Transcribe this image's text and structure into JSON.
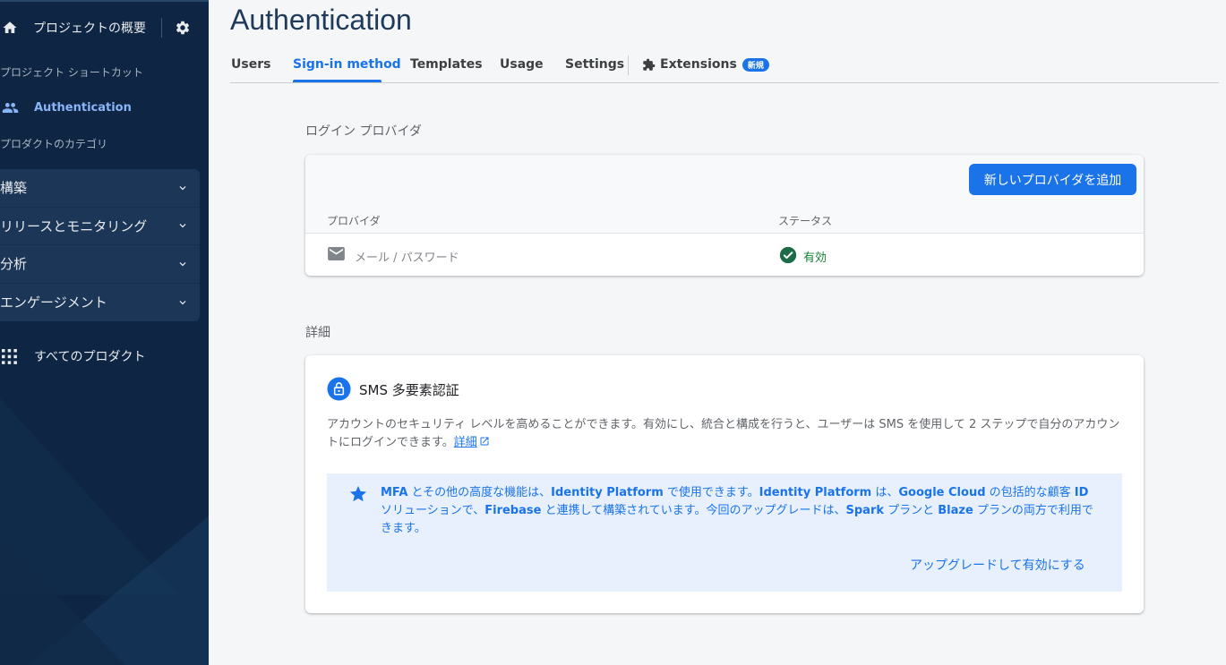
{
  "sidebar": {
    "overview_label": "プロジェクトの概要",
    "shortcuts_header": "プロジェクト ショートカット",
    "auth_label": "Authentication",
    "categories_header": "プロダクトのカテゴリ",
    "categories": [
      {
        "label": "構築"
      },
      {
        "label": "リリースとモニタリング"
      },
      {
        "label": "分析"
      },
      {
        "label": "エンゲージメント"
      }
    ],
    "all_products_label": "すべてのプロダクト"
  },
  "main": {
    "title": "Authentication",
    "tabs": [
      {
        "label": "Users"
      },
      {
        "label": "Sign-in method"
      },
      {
        "label": "Templates"
      },
      {
        "label": "Usage"
      },
      {
        "label": "Settings"
      }
    ],
    "extensions_label": "Extensions",
    "new_badge": "新規"
  },
  "providers": {
    "section_label": "ログイン プロバイダ",
    "add_button": "新しいプロバイダを追加",
    "col_provider": "プロバイダ",
    "col_status": "ステータス",
    "rows": [
      {
        "provider": "メール / パスワード",
        "status": "有効"
      }
    ]
  },
  "details": {
    "section_label": "詳細",
    "sms_title": "SMS 多要素認証",
    "sms_desc": "アカウントのセキュリティ レベルを高めることができます。有効にし、統合と構成を行うと、ユーザーは SMS を使用して 2 ステップで自分のアカウントにログインできます。",
    "details_link": "詳細",
    "info": {
      "p1": "MFA",
      "p2": " とその他の高度な機能は、",
      "p3": "Identity Platform",
      "p4": " で使用できます。",
      "p5": "Identity Platform",
      "p6": " は、",
      "p7": "Google Cloud",
      "p8": " の包括的な顧客 ",
      "p9": "ID",
      "p10": " ソリューションで、",
      "p11": "Firebase",
      "p12": " と連携して構築されています。今回のアップグレードは、",
      "p13": "Spark",
      "p14": " プランと ",
      "p15": "Blaze",
      "p16": " プランの両方で利用できます。"
    },
    "upgrade_link": "アップグレードして有効にする"
  },
  "colors": {
    "sidebar_bg": "#0e2644",
    "accent": "#1a73e8",
    "success": "#188038"
  }
}
